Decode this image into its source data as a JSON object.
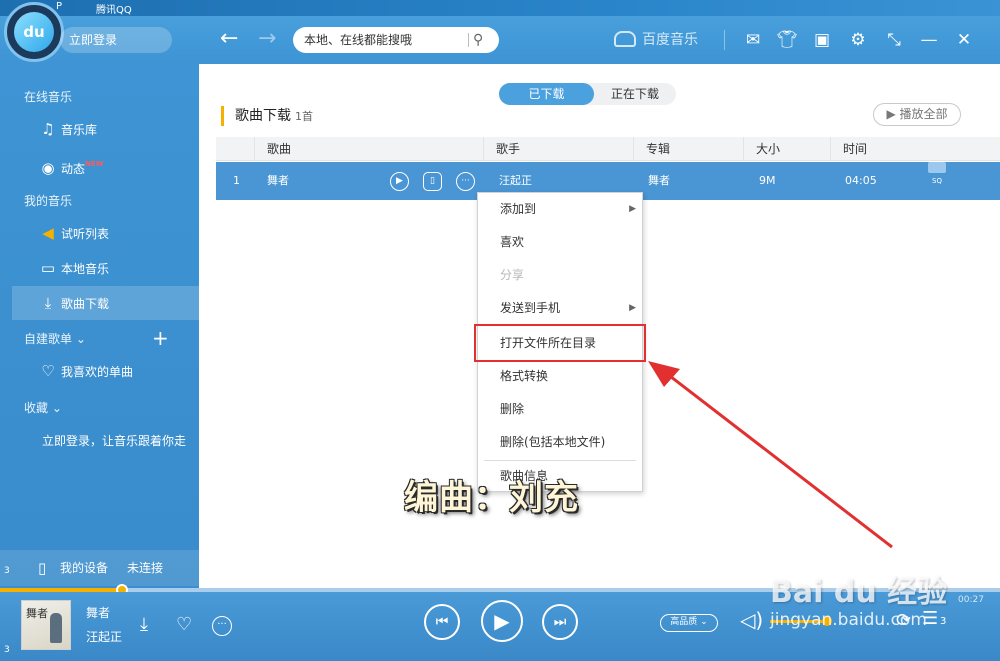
{
  "desktop": {
    "top_text_1": "P",
    "top_text_2": "腾讯QQ",
    "edge_1": "3",
    "edge_2": "3"
  },
  "header": {
    "logo_text": "du",
    "login_label": "立即登录",
    "search_placeholder": "本地、在线都能搜哦",
    "brand": "百度音乐"
  },
  "sidebar": {
    "section_online": "在线音乐",
    "music_library": "音乐库",
    "dynamics": "动态",
    "new_badge": "NEW",
    "section_my": "我的音乐",
    "trial_list": "试听列表",
    "local_music": "本地音乐",
    "downloads": "歌曲下载",
    "custom_playlists": "自建歌单",
    "favorites": "我喜欢的单曲",
    "collections": "收藏",
    "login_prompt": "立即登录，让音乐跟着你走",
    "device_label": "我的设备",
    "device_status": "未连接"
  },
  "main": {
    "tab_downloaded": "已下载",
    "tab_downloading": "正在下载",
    "title": "歌曲下载",
    "count": "1首",
    "play_all": "播放全部",
    "columns": {
      "song": "歌曲",
      "artist": "歌手",
      "album": "专辑",
      "size": "大小",
      "time": "时间"
    },
    "rows": [
      {
        "index": "1",
        "song": "舞者",
        "artist": "汪起正",
        "album": "舞者",
        "size": "9M",
        "time": "04:05",
        "quality": "SQ"
      }
    ]
  },
  "context_menu": {
    "items": [
      {
        "label": "添加到",
        "submenu": true,
        "disabled": false
      },
      {
        "label": "喜欢",
        "submenu": false,
        "disabled": false
      },
      {
        "label": "分享",
        "submenu": false,
        "disabled": true
      },
      {
        "label": "发送到手机",
        "submenu": true,
        "disabled": false
      },
      {
        "label": "打开文件所在目录",
        "submenu": false,
        "disabled": false,
        "highlighted": true
      },
      {
        "label": "格式转换",
        "submenu": false,
        "disabled": false
      },
      {
        "label": "删除",
        "submenu": false,
        "disabled": false
      },
      {
        "label": "删除(包括本地文件)",
        "submenu": false,
        "disabled": false
      },
      {
        "label": "歌曲信息",
        "submenu": false,
        "disabled": false
      }
    ]
  },
  "annotation": {
    "composer_text": "编曲：刘充"
  },
  "player": {
    "title": "舞者",
    "artist": "汪起正",
    "cover_text": "舞者",
    "quality": "高品质",
    "elapsed": "00:27",
    "progress_fraction": 0.12,
    "volume_fraction": 0.85,
    "playlist_count": "3"
  },
  "watermark": {
    "logo": "Bai du 经验",
    "site": "jingyan.baidu.com"
  },
  "colors": {
    "accent": "#4ba0de",
    "highlight": "#f5b100",
    "annotation_box": "#e23030"
  }
}
